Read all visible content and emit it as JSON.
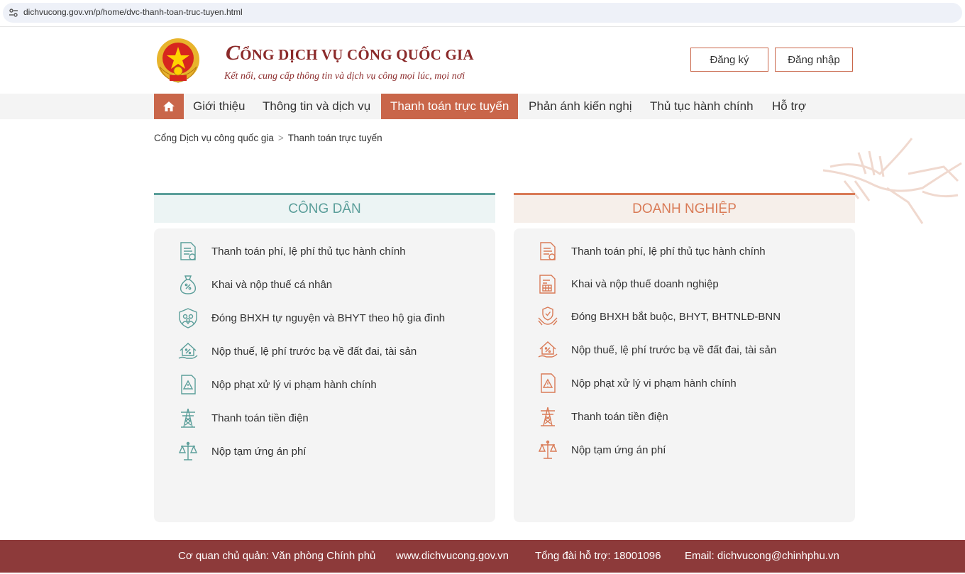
{
  "browser": {
    "url": "dichvucong.gov.vn/p/home/dvc-thanh-toan-truc-tuyen.html",
    "icon": "site-settings-icon"
  },
  "header": {
    "title_initial": "C",
    "title_rest": "ỔNG DỊCH VỤ CÔNG QUỐC GIA",
    "subtitle": "Kết nối, cung cấp thông tin và dịch vụ công mọi lúc, mọi nơi",
    "register_label": "Đăng ký",
    "login_label": "Đăng nhập"
  },
  "nav": {
    "items": [
      {
        "label": "Giới thiệu"
      },
      {
        "label": "Thông tin và dịch vụ"
      },
      {
        "label": "Thanh toán trực tuyến"
      },
      {
        "label": "Phản ánh kiến nghị"
      },
      {
        "label": "Thủ tục hành chính"
      },
      {
        "label": "Hỗ trợ"
      }
    ],
    "active_index": 2,
    "active_color": "#c9664a"
  },
  "breadcrumb": {
    "home": "Cổng Dịch vụ công quốc gia",
    "separator": ">",
    "current": "Thanh toán trực tuyến"
  },
  "cong_dan": {
    "title": "CÔNG DÂN",
    "accent": "#5b9e9a",
    "items": [
      {
        "label": "Thanh toán phí, lệ phí thủ tục hành chính",
        "icon": "document-fee-icon"
      },
      {
        "label": "Khai và nộp thuế cá nhân",
        "icon": "money-bag-icon"
      },
      {
        "label": "Đóng BHXH tự nguyện và BHYT theo hộ gia đình",
        "icon": "family-shield-icon"
      },
      {
        "label": "Nộp thuế, lệ phí trước bạ về đất đai, tài sản",
        "icon": "house-percent-icon"
      },
      {
        "label": "Nộp phạt xử lý vi phạm hành chính",
        "icon": "warning-document-icon"
      },
      {
        "label": "Thanh toán tiền điện",
        "icon": "power-tower-icon"
      },
      {
        "label": "Nộp tạm ứng án phí",
        "icon": "scales-icon"
      }
    ]
  },
  "doanh_nghiep": {
    "title": "DOANH NGHIỆP",
    "accent": "#d97b57",
    "items": [
      {
        "label": "Thanh toán phí, lệ phí thủ tục hành chính",
        "icon": "document-fee-icon"
      },
      {
        "label": "Khai và nộp thuế doanh nghiệp",
        "icon": "tax-document-icon"
      },
      {
        "label": "Đóng BHXH bắt buộc, BHYT, BHTNLĐ-BNN",
        "icon": "hands-shield-icon"
      },
      {
        "label": "Nộp thuế, lệ phí trước bạ về đất đai, tài sản",
        "icon": "house-percent-icon"
      },
      {
        "label": "Nộp phạt xử lý vi phạm hành chính",
        "icon": "warning-document-icon"
      },
      {
        "label": "Thanh toán tiền điện",
        "icon": "power-tower-icon"
      },
      {
        "label": "Nộp tạm ứng án phí",
        "icon": "scales-icon"
      }
    ]
  },
  "footer": {
    "agency": "Cơ quan chủ quản: Văn phòng Chính phủ",
    "website": "www.dichvucong.gov.vn",
    "hotline": "Tổng đài hỗ trợ: 18001096",
    "email": "Email: dichvucong@chinhphu.vn"
  }
}
